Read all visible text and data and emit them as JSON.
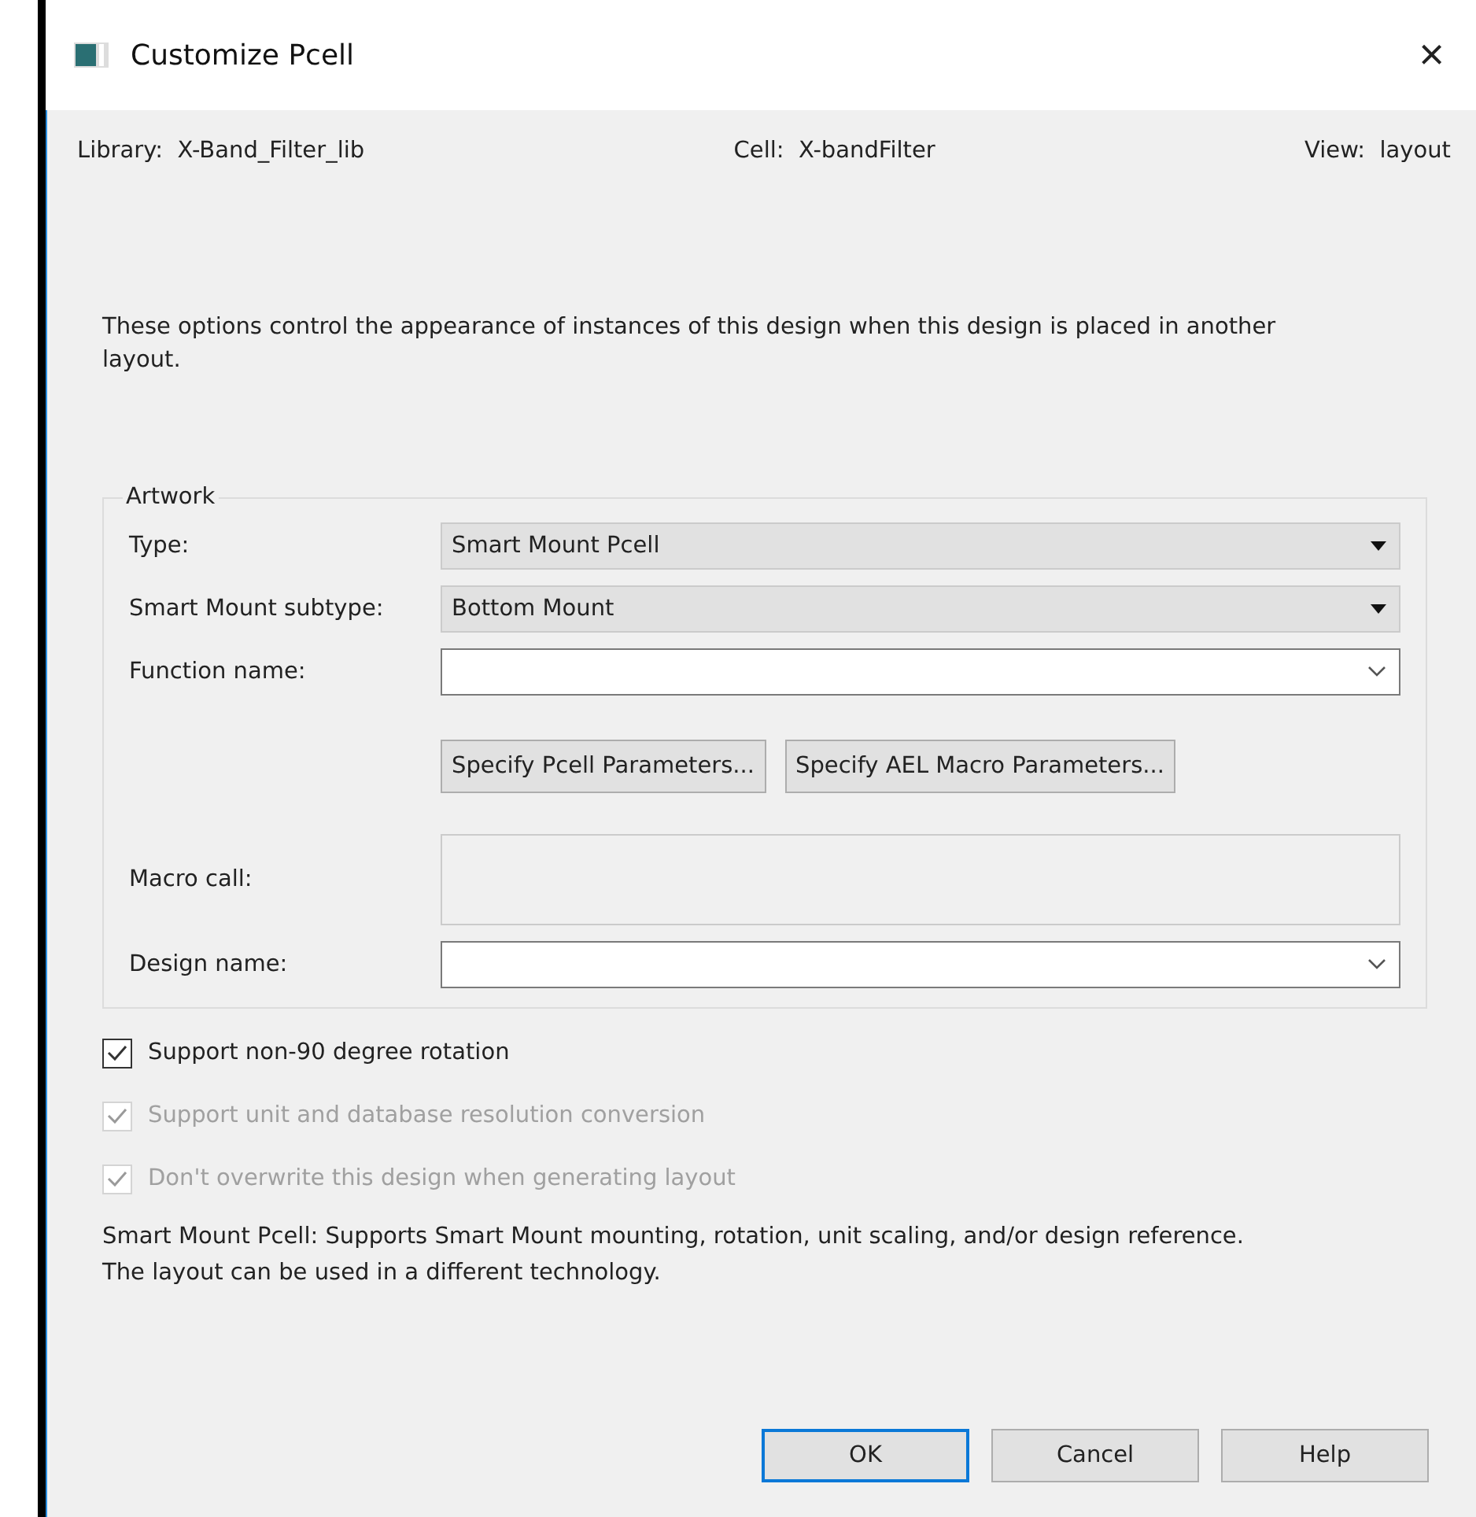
{
  "window": {
    "title": "Customize Pcell",
    "close": "×"
  },
  "context": [
    {
      "label": "Library:",
      "value": "X-Band_Filter_lib"
    },
    {
      "label": "Cell:",
      "value": "X-bandFilter"
    },
    {
      "label": "View:",
      "value": "layout"
    }
  ],
  "description": "These options control the appearance of instances of this design when this design is placed in another layout.",
  "artwork": {
    "legend": "Artwork",
    "rows": [
      {
        "kind": "dropdown",
        "label": "Type:",
        "value": "Smart Mount Pcell"
      },
      {
        "kind": "dropdown",
        "label": "Smart Mount subtype:",
        "value": "Bottom Mount"
      },
      {
        "kind": "combo",
        "label": "Function name:"
      },
      {
        "kind": "buttons",
        "buttons": [
          "Specify Pcell Parameters...",
          "Specify AEL Macro Parameters..."
        ]
      },
      {
        "kind": "area",
        "label": "Macro call:"
      },
      {
        "kind": "combo",
        "label": "Design name:"
      }
    ]
  },
  "options": [
    {
      "label": "Support non-90 degree rotation",
      "checked": true,
      "disabled": false
    },
    {
      "label": "Support unit and database resolution conversion",
      "checked": true,
      "disabled": true
    },
    {
      "label": "Don't overwrite this design when generating layout",
      "checked": true,
      "disabled": true
    }
  ],
  "info": [
    "Smart Mount Pcell: Supports Smart Mount mounting, rotation, unit scaling, and/or design reference.",
    "The layout can be used in a different technology."
  ],
  "buttons": [
    {
      "label": "OK",
      "default": true
    },
    {
      "label": "Cancel",
      "default": false
    },
    {
      "label": "Help",
      "default": false
    }
  ]
}
